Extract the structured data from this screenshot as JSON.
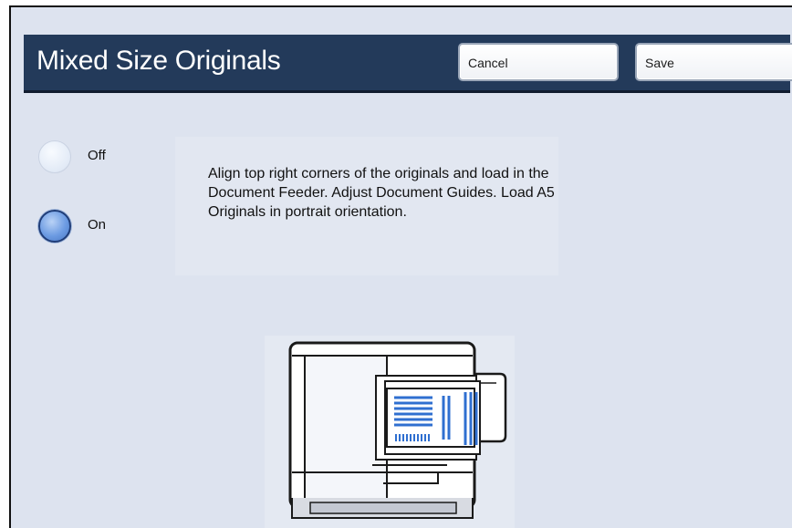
{
  "header": {
    "title": "Mixed Size Originals",
    "cancel_label": "Cancel",
    "save_label": "Save"
  },
  "options": [
    {
      "label": "Off",
      "selected": false
    },
    {
      "label": "On",
      "selected": true
    }
  ],
  "instructions": "Align top right corners of the originals and load in the Document Feeder.  Adjust Document Guides.  Load A5 Originals in portrait orientation.",
  "illustration": {
    "icon": "document-feeder-icon"
  },
  "colors": {
    "header_bg": "#233a5a",
    "screen_bg": "#dde3ef",
    "accent_blue": "#2f6fd0",
    "selected_radio": "#5f8fdc"
  }
}
